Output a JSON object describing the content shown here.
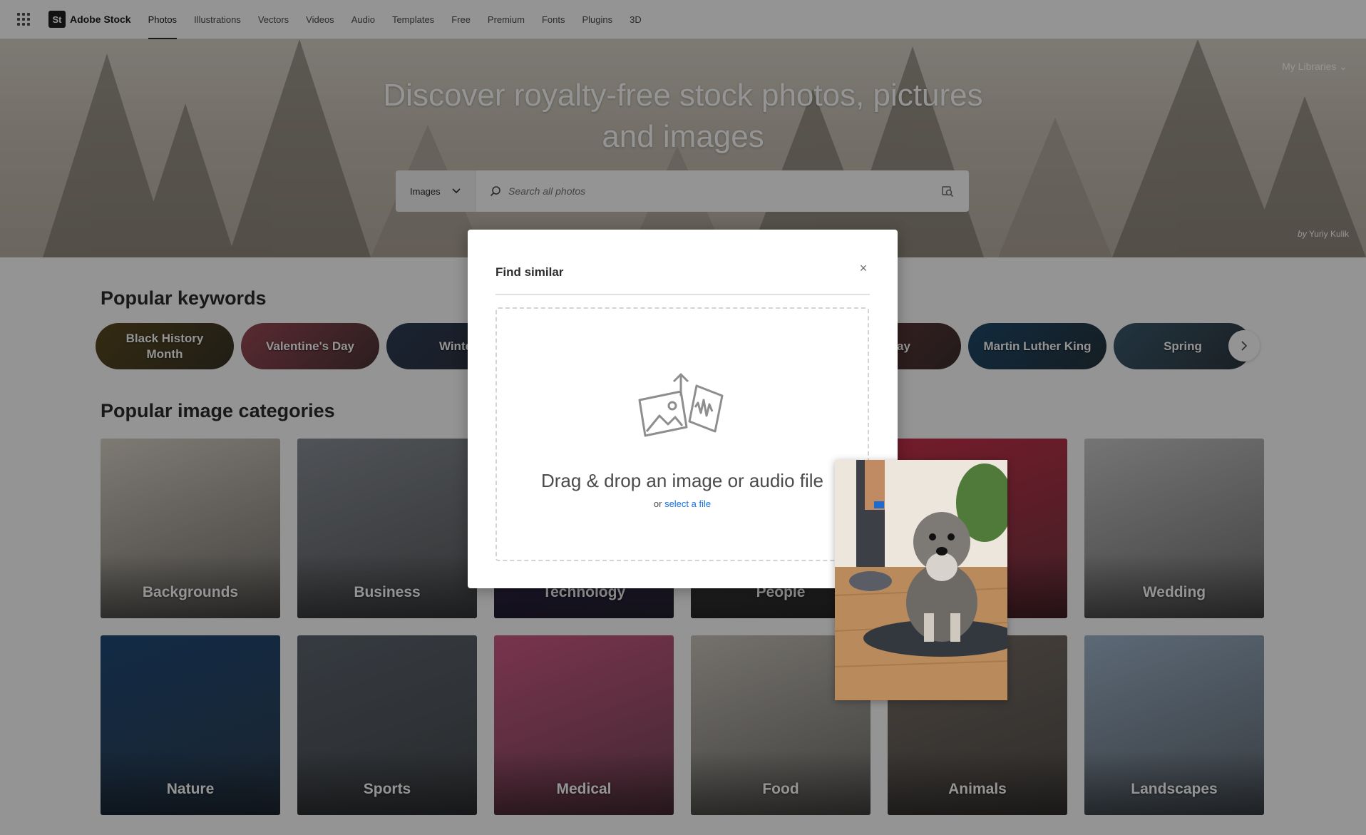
{
  "brand": {
    "mark": "St",
    "name": "Adobe Stock"
  },
  "nav": {
    "tabs": [
      {
        "label": "Photos",
        "active": true
      },
      {
        "label": "Illustrations"
      },
      {
        "label": "Vectors"
      },
      {
        "label": "Videos"
      },
      {
        "label": "Audio"
      },
      {
        "label": "Templates"
      },
      {
        "label": "Free"
      },
      {
        "label": "Premium"
      },
      {
        "label": "Fonts"
      },
      {
        "label": "Plugins"
      },
      {
        "label": "3D"
      }
    ]
  },
  "hero": {
    "title_line1": "Discover royalty-free stock photos, pictures",
    "title_line2": "and images",
    "my_libraries": "My Libraries",
    "credit_by": "by",
    "credit_name": "Yuriy Kulik"
  },
  "search": {
    "type_value": "Images",
    "placeholder": "Search all photos"
  },
  "keywords": {
    "title": "Popular keywords",
    "items": [
      {
        "label": "Black History Month",
        "color": "#5a4a1e"
      },
      {
        "label": "Valentine's Day",
        "color": "#9b4a55"
      },
      {
        "label": "Winte",
        "color": "#2f3d58"
      },
      {
        "label": "",
        "color": "#5b5b5b"
      },
      {
        "label": "",
        "color": "#5b5b5b"
      },
      {
        "label": "rthday",
        "color": "#6b3a3a"
      },
      {
        "label": "Martin Luther King",
        "color": "#1d4a6b"
      },
      {
        "label": "Spring",
        "color": "#3a5a6e"
      }
    ]
  },
  "categories": {
    "title": "Popular image categories",
    "items": [
      {
        "label": "Backgrounds",
        "color": "#d9d2c7"
      },
      {
        "label": "Business",
        "color": "#8a8f96"
      },
      {
        "label": "Technology",
        "color": "#3b2a6e"
      },
      {
        "label": "People",
        "color": "#4a4a4a"
      },
      {
        "label": "",
        "color": "#c8304a"
      },
      {
        "label": "Wedding",
        "color": "#c9c9c9"
      },
      {
        "label": "Nature",
        "color": "#1f4a78"
      },
      {
        "label": "Sports",
        "color": "#5e6670"
      },
      {
        "label": "Medical",
        "color": "#d05a86"
      },
      {
        "label": "Food",
        "color": "#c9c4bc"
      },
      {
        "label": "Animals",
        "color": "#7a7068"
      },
      {
        "label": "Landscapes",
        "color": "#9fb5cc"
      }
    ]
  },
  "modal": {
    "title": "Find similar",
    "close_glyph": "×",
    "drop_text": "Drag & drop an image or audio file",
    "sub_prefix": "or",
    "select_link": "select a file"
  }
}
